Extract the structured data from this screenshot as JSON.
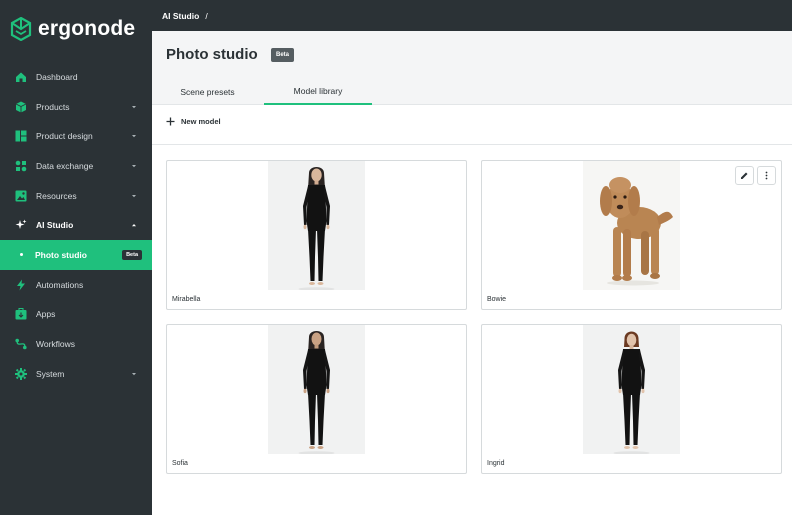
{
  "app": {
    "name": "ergonode",
    "brand_color": "#1fc07d",
    "sidebar_color": "#2b3236"
  },
  "sidebar": {
    "items": [
      {
        "label": "Dashboard",
        "icon": "home-icon",
        "has_chevron": false
      },
      {
        "label": "Products",
        "icon": "cube-icon",
        "has_chevron": true
      },
      {
        "label": "Product design",
        "icon": "layout-icon",
        "has_chevron": true
      },
      {
        "label": "Data exchange",
        "icon": "exchange-icon",
        "has_chevron": true
      },
      {
        "label": "Resources",
        "icon": "image-icon",
        "has_chevron": true
      },
      {
        "label": "AI Studio",
        "icon": "sparkle-icon",
        "has_chevron": true,
        "expanded": true
      },
      {
        "label": "Automations",
        "icon": "bolt-icon",
        "has_chevron": false
      },
      {
        "label": "Apps",
        "icon": "apps-icon",
        "has_chevron": false
      },
      {
        "label": "Workflows",
        "icon": "workflow-icon",
        "has_chevron": false
      },
      {
        "label": "System",
        "icon": "gear-icon",
        "has_chevron": true
      }
    ],
    "sub_item": {
      "label": "Photo studio",
      "badge": "Beta"
    }
  },
  "topbar": {
    "breadcrumb": "AI Studio",
    "separator": "/"
  },
  "header": {
    "title": "Photo studio",
    "badge": "Beta",
    "tabs": [
      {
        "label": "Scene presets",
        "active": false
      },
      {
        "label": "Model library",
        "active": true
      }
    ]
  },
  "toolbar": {
    "new_label": "New model"
  },
  "models": [
    {
      "name": "Mirabella",
      "type": "person",
      "hair": "long-dark"
    },
    {
      "name": "Bowie",
      "type": "dog"
    },
    {
      "name": "Sofia",
      "type": "person",
      "hair": "long-dark"
    },
    {
      "name": "Ingrid",
      "type": "person",
      "hair": "short-auburn"
    }
  ]
}
